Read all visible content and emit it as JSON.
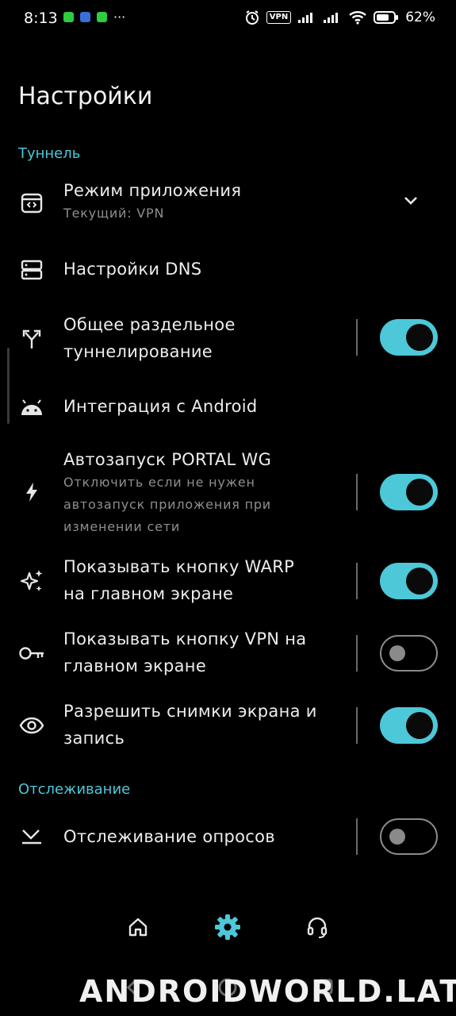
{
  "status_bar": {
    "time": "8:13",
    "dots": "···",
    "vpn": "VPN",
    "battery": "62%"
  },
  "page": {
    "title": "Настройки"
  },
  "sections": {
    "tunnel": "Туннель",
    "monitoring": "Отслеживание"
  },
  "items": {
    "app_mode": {
      "title": "Режим приложения",
      "subtitle": "Текущий: VPN",
      "icon": "app-window-icon"
    },
    "dns": {
      "title": "Настройки DNS",
      "icon": "dns-server-icon"
    },
    "split_tunnel": {
      "title_line1": "Общее раздельное",
      "title_line2": "туннелирование",
      "icon": "split-arrow-icon",
      "enabled": true
    },
    "android_integration": {
      "title": "Интеграция с Android",
      "icon": "android-icon"
    },
    "autostart": {
      "title": "Автозапуск PORTAL WG",
      "sub_line1": "Отключить если не нужен",
      "sub_line2": "автозапуск приложения при",
      "sub_line3": "изменении сети",
      "icon": "bolt-icon",
      "enabled": true
    },
    "warp_button": {
      "title_line1": "Показывать кнопку WARP",
      "title_line2": "на главном экране",
      "icon": "sparkles-icon",
      "enabled": true
    },
    "vpn_button": {
      "title_line1": "Показывать кнопку VPN на",
      "title_line2": "главном экране",
      "icon": "key-icon",
      "enabled": false
    },
    "screenshots": {
      "title_line1": "Разрешить снимки экрана и",
      "title_line2": "запись",
      "icon": "eye-icon",
      "enabled": true
    },
    "ping_monitoring": {
      "title": "Отслеживание опросов",
      "icon": "ping-icon",
      "enabled": false
    }
  },
  "bottom_nav": {
    "items": [
      {
        "name": "home",
        "icon": "home-icon",
        "active": false
      },
      {
        "name": "settings",
        "icon": "gear-icon",
        "active": true
      },
      {
        "name": "support",
        "icon": "headset-icon",
        "active": false
      }
    ]
  },
  "watermark": "ANDROIDWORLD.LAT",
  "colors": {
    "accent": "#4cc8d8",
    "background": "#000000",
    "text": "#ededed",
    "subtext": "#8e8e8e"
  }
}
